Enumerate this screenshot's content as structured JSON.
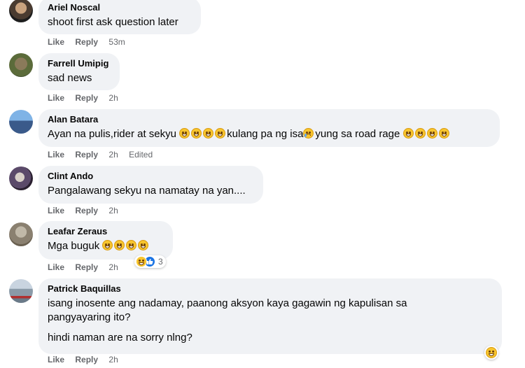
{
  "comments": [
    {
      "author": "Ariel Noscal",
      "lines": [
        "shoot first ask question later"
      ],
      "like": "Like",
      "reply": "Reply",
      "time": "53m",
      "edited": ""
    },
    {
      "author": "Farrell Umipig",
      "lines": [
        "sad news"
      ],
      "like": "Like",
      "reply": "Reply",
      "time": "2h",
      "edited": ""
    },
    {
      "author": "Alan Batara",
      "text_a": "Ayan na pulis,rider at sekyu ",
      "text_b": "kulang pa ng isa",
      "text_c": "yung sa road rage ",
      "like": "Like",
      "reply": "Reply",
      "time": "2h",
      "edited": "Edited"
    },
    {
      "author": "Clint Ando",
      "lines": [
        "Pangalawang sekyu na namatay na yan...."
      ],
      "like": "Like",
      "reply": "Reply",
      "time": "2h",
      "edited": ""
    },
    {
      "author": "Leafar Zeraus",
      "text_a": "Mga buguk ",
      "like": "Like",
      "reply": "Reply",
      "time": "2h",
      "reaction_count": "3"
    },
    {
      "author": "Patrick Baquillas",
      "lines": [
        "isang inosente ang nadamay, paanong aksyon kaya gagawin ng kapulisan sa",
        "pangyayaring ito?",
        "hindi naman are na sorry nlng?"
      ],
      "like": "Like",
      "reply": "Reply",
      "time": "2h"
    }
  ],
  "icons": {
    "grin_emoji": "grinning-squinting-face-icon",
    "sad_emoji": "crying-face-icon",
    "haha_reaction": "haha-reaction-icon",
    "like_reaction": "like-reaction-icon"
  },
  "colors": {
    "bubble": "#f0f2f5",
    "meta_text": "#65676b",
    "like_blue": "#1b74e4",
    "emoji_yellow": "#f7c52e"
  }
}
